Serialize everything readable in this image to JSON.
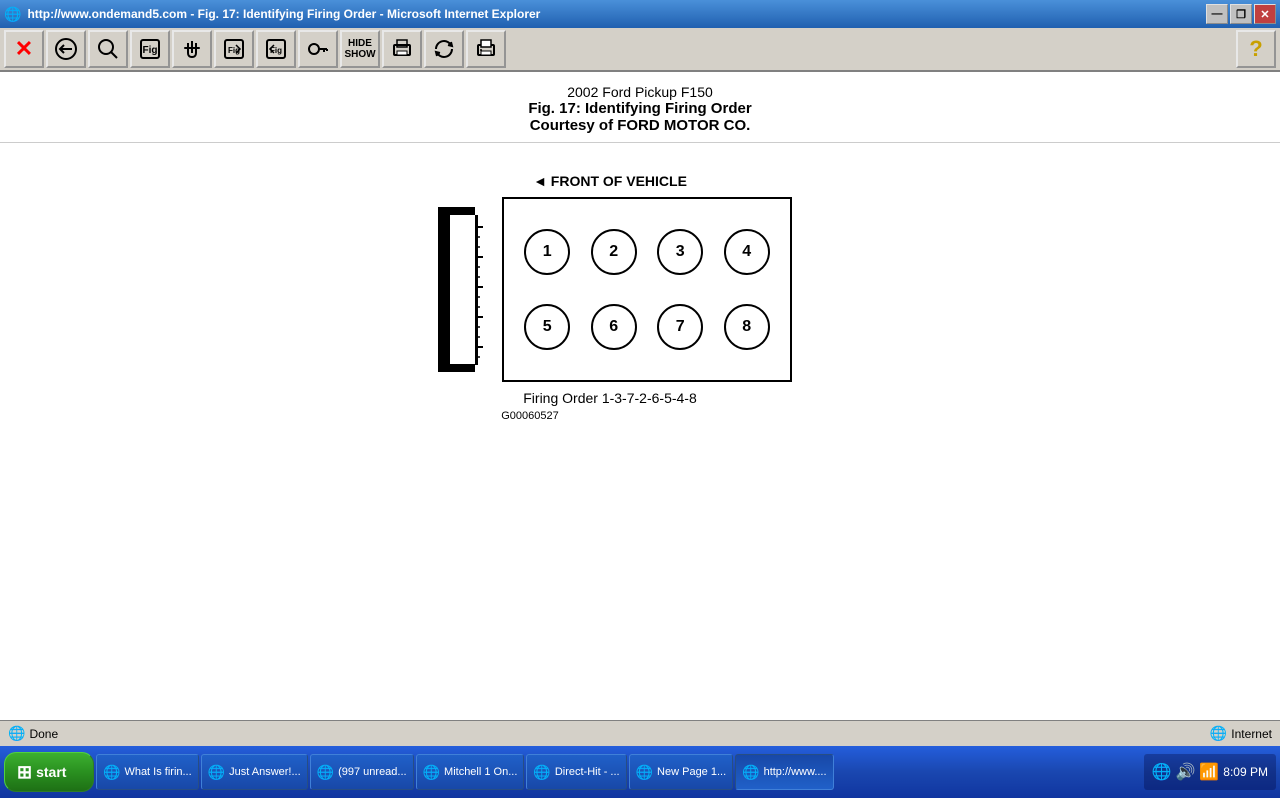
{
  "window": {
    "title": "http://www.ondemand5.com - Fig. 17: Identifying Firing Order - Microsoft Internet Explorer",
    "icon": "🌐"
  },
  "toolbar": {
    "buttons": [
      {
        "id": "close",
        "icon": "✕",
        "label": "close-button"
      },
      {
        "id": "back",
        "icon": "🔍",
        "label": "back-button"
      },
      {
        "id": "search",
        "icon": "🔍",
        "label": "search-button"
      },
      {
        "id": "fig",
        "icon": "📄",
        "label": "fig-button"
      },
      {
        "id": "hand",
        "icon": "✋",
        "label": "hand-button"
      },
      {
        "id": "fig2",
        "icon": "📋",
        "label": "fig2-button"
      },
      {
        "id": "fig3",
        "icon": "📋",
        "label": "fig3-button"
      },
      {
        "id": "key",
        "icon": "🔑",
        "label": "key-button"
      },
      {
        "id": "hideshow",
        "icon": "👁",
        "label": "hideshow-button"
      },
      {
        "id": "print",
        "icon": "🖨",
        "label": "print-button"
      },
      {
        "id": "refresh",
        "icon": "🔄",
        "label": "refresh-button"
      },
      {
        "id": "print2",
        "icon": "🖨",
        "label": "print2-button"
      }
    ],
    "help_icon": "?"
  },
  "content": {
    "title1": "2002 Ford Pickup F150",
    "title2": "Fig. 17: Identifying Firing Order",
    "title3": "Courtesy of FORD MOTOR CO.",
    "front_label": "◄ FRONT OF VEHICLE",
    "cylinders_top": [
      "1",
      "2",
      "3",
      "4"
    ],
    "cylinders_bottom": [
      "5",
      "6",
      "7",
      "8"
    ],
    "firing_order": "Firing Order 1-3-7-2-6-5-4-8",
    "part_number": "G00060527"
  },
  "status_bar": {
    "status": "Done",
    "zone": "Internet"
  },
  "taskbar": {
    "start_label": "start",
    "time": "8:09 PM",
    "items": [
      {
        "label": "What Is firin...",
        "icon": "🌐",
        "active": false
      },
      {
        "label": "Just Answer!...",
        "icon": "🌐",
        "active": false
      },
      {
        "label": "(997 unread...",
        "icon": "🌐",
        "active": false
      },
      {
        "label": "Mitchell 1 On...",
        "icon": "🌐",
        "active": false
      },
      {
        "label": "Direct-Hit - ...",
        "icon": "🌐",
        "active": false
      },
      {
        "label": "New Page 1...",
        "icon": "🌐",
        "active": false
      },
      {
        "label": "http://www....",
        "icon": "🌐",
        "active": true
      }
    ]
  }
}
